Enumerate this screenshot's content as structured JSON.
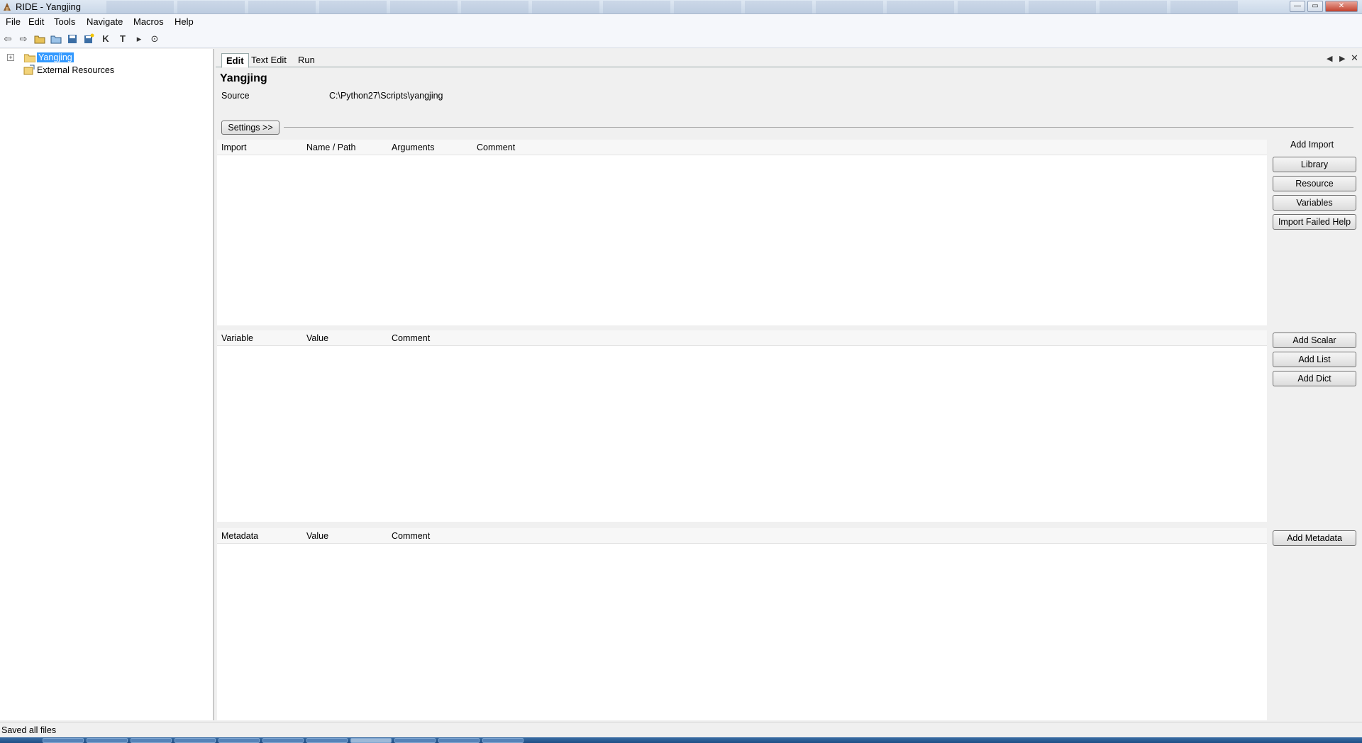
{
  "window": {
    "title": "RIDE - Yangjing",
    "minimize": "—",
    "maximize": "▭",
    "close": "✕"
  },
  "menu": [
    "File",
    "Edit",
    "Tools",
    "Navigate",
    "Macros",
    "Help"
  ],
  "toolbar": {
    "icons": [
      "back-arrow-icon",
      "forward-arrow-icon",
      "open-folder-icon",
      "open-directory-icon",
      "save-icon",
      "save-all-icon",
      "keyword-search-icon",
      "test-search-icon",
      "run-icon",
      "stop-icon"
    ]
  },
  "tree": {
    "root": "Yangjing",
    "external": "External Resources",
    "expander": "+"
  },
  "tabs": [
    "Edit",
    "Text Edit",
    "Run"
  ],
  "editor": {
    "title": "Yangjing",
    "source_label": "Source",
    "source_value": "C:\\Python27\\Scripts\\yangjing",
    "settings_button": "Settings >>"
  },
  "imports": {
    "columns": [
      "Import",
      "Name / Path",
      "Arguments",
      "Comment"
    ],
    "add_label": "Add Import",
    "buttons": [
      "Library",
      "Resource",
      "Variables",
      "Import Failed Help"
    ]
  },
  "variables": {
    "columns": [
      "Variable",
      "Value",
      "Comment"
    ],
    "buttons": [
      "Add Scalar",
      "Add List",
      "Add Dict"
    ]
  },
  "metadata": {
    "columns": [
      "Metadata",
      "Value",
      "Comment"
    ],
    "buttons": [
      "Add Metadata"
    ]
  },
  "status": "Saved all files",
  "colors": {
    "selection": "#3399ff",
    "taskbar": "#2a5d95"
  }
}
